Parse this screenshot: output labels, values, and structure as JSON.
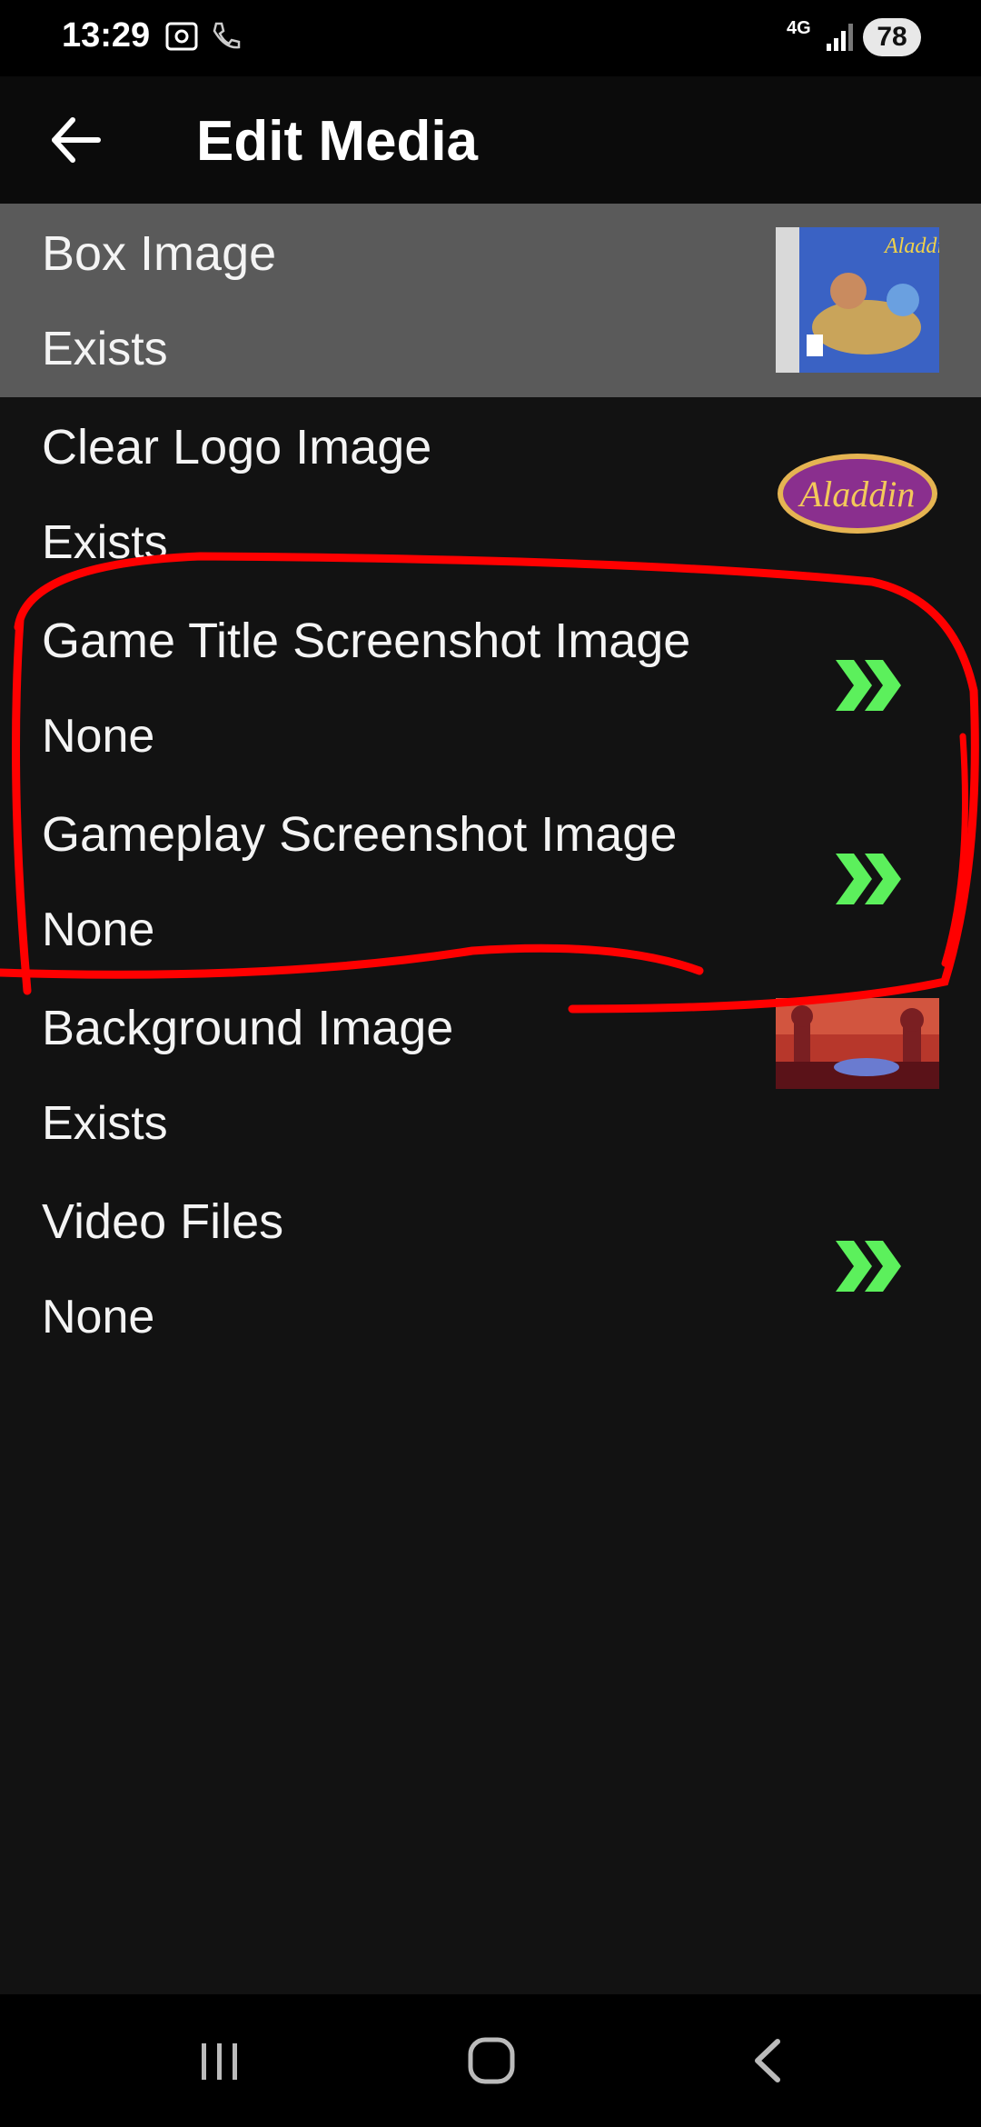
{
  "status_bar": {
    "time": "13:29",
    "network": "4G",
    "battery": "78"
  },
  "app_bar": {
    "title": "Edit Media",
    "back_icon": "arrow-left-icon"
  },
  "media_items": [
    {
      "title": "Box Image",
      "status": "Exists",
      "preview": "box-art-thumbnail",
      "thumb_text": "Aladdin"
    },
    {
      "title": "Clear Logo Image",
      "status": "Exists",
      "preview": "logo-thumbnail",
      "thumb_text": "Aladdin"
    },
    {
      "title": "Game Title Screenshot Image",
      "status": "None",
      "preview": "chevron-icon"
    },
    {
      "title": "Gameplay Screenshot Image",
      "status": "None",
      "preview": "chevron-icon"
    },
    {
      "title": "Background Image",
      "status": "Exists",
      "preview": "background-thumbnail"
    },
    {
      "title": "Video Files",
      "status": "None",
      "preview": "chevron-icon"
    }
  ],
  "colors": {
    "accent_green": "#5cf05c",
    "annotation_red": "#ff0000",
    "selected_row": "#5a5a5a",
    "background": "#121212"
  },
  "nav_bar": {
    "recent_icon": "recent-apps-icon",
    "home_icon": "home-icon",
    "back_icon": "nav-back-icon"
  }
}
